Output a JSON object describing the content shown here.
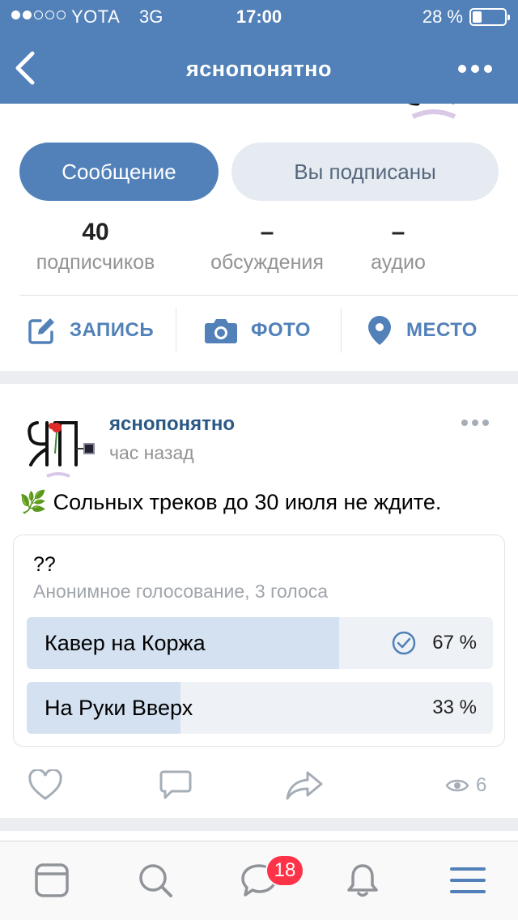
{
  "status_bar": {
    "carrier": "YOTA",
    "network": "3G",
    "time": "17:00",
    "battery": "28 %",
    "battery_level": 0.28,
    "signal_bars_filled": 2,
    "signal_bars_total": 5
  },
  "nav": {
    "title": "яснопонятно",
    "back_icon": "chevron-left-icon",
    "more_icon": "more-horizontal-icon"
  },
  "profile": {
    "message_button": "Сообщение",
    "subscribed_button": "Вы подписаны",
    "counters": [
      {
        "value": "40",
        "label": "подписчиков"
      },
      {
        "value": "–",
        "label": "обсуждения"
      },
      {
        "value": "–",
        "label": "аудио"
      }
    ],
    "actions": [
      {
        "icon": "edit-icon",
        "label": "ЗАПИСЬ"
      },
      {
        "icon": "camera-icon",
        "label": "ФОТО"
      },
      {
        "icon": "location-pin-icon",
        "label": "МЕСТО"
      }
    ]
  },
  "post": {
    "author": "яснопонятно",
    "time": "час назад",
    "text": "Сольных треков до 30 июля не ждите.",
    "emoji": "🌿",
    "poll": {
      "question": "??",
      "meta": "Анонимное голосование, 3 голоса",
      "options": [
        {
          "text": "Кавер на Коржа",
          "percent": "67 %",
          "share": 0.67,
          "voted": true
        },
        {
          "text": "На Руки Вверх",
          "percent": "33 %",
          "share": 0.33,
          "voted": false
        }
      ]
    },
    "footer": {
      "views": "6",
      "like_icon": "heart-icon",
      "comment_icon": "comment-icon",
      "share_icon": "share-arrow-icon",
      "views_icon": "eye-icon"
    }
  },
  "tabbar": {
    "tabs": [
      {
        "name": "news",
        "icon": "news-feed-icon"
      },
      {
        "name": "search",
        "icon": "search-icon"
      },
      {
        "name": "messages",
        "icon": "messages-icon"
      },
      {
        "name": "notifications",
        "icon": "bell-icon"
      },
      {
        "name": "menu",
        "icon": "menu-icon"
      }
    ],
    "messages_badge": "18"
  },
  "colors": {
    "brand": "#5181b8",
    "link": "#2a5885",
    "badge": "#ff3347",
    "poll_fill": "#d4e1f1"
  }
}
